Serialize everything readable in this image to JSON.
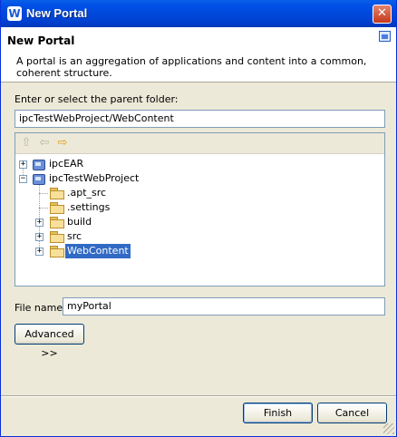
{
  "window": {
    "title": "New Portal",
    "close_symbol": "✕",
    "app_icon_glyph": "W"
  },
  "header": {
    "title": "New Portal",
    "description": "A portal is an aggregation of applications and content into a common, coherent structure."
  },
  "parent_folder": {
    "label": "Enter or select the parent folder:",
    "value": "ipcTestWebProject/WebContent"
  },
  "tree_toolbar": {
    "up_icon": "up-arrow",
    "back_icon": "back-arrow",
    "forward_icon": "forward-arrow"
  },
  "tree": {
    "items": [
      {
        "label": "ipcEAR",
        "expander": "+",
        "icon": "project-icon"
      },
      {
        "label": "ipcTestWebProject",
        "expander": "−",
        "icon": "web-project-icon"
      },
      {
        "label": ".apt_src",
        "icon": "folder-icon"
      },
      {
        "label": ".settings",
        "icon": "folder-icon"
      },
      {
        "label": "build",
        "expander": "+",
        "icon": "folder-icon"
      },
      {
        "label": "src",
        "expander": "+",
        "icon": "folder-icon"
      },
      {
        "label": "WebContent",
        "expander": "+",
        "icon": "folder-icon",
        "selected": true
      }
    ]
  },
  "file_name": {
    "label": "File name:",
    "value": "myPortal"
  },
  "buttons": {
    "advanced": "Advanced >>",
    "finish": "Finish",
    "cancel": "Cancel"
  },
  "colors": {
    "title_bar": "#0054e3",
    "selection": "#316ac5",
    "dialog_bg": "#ece9d8"
  }
}
